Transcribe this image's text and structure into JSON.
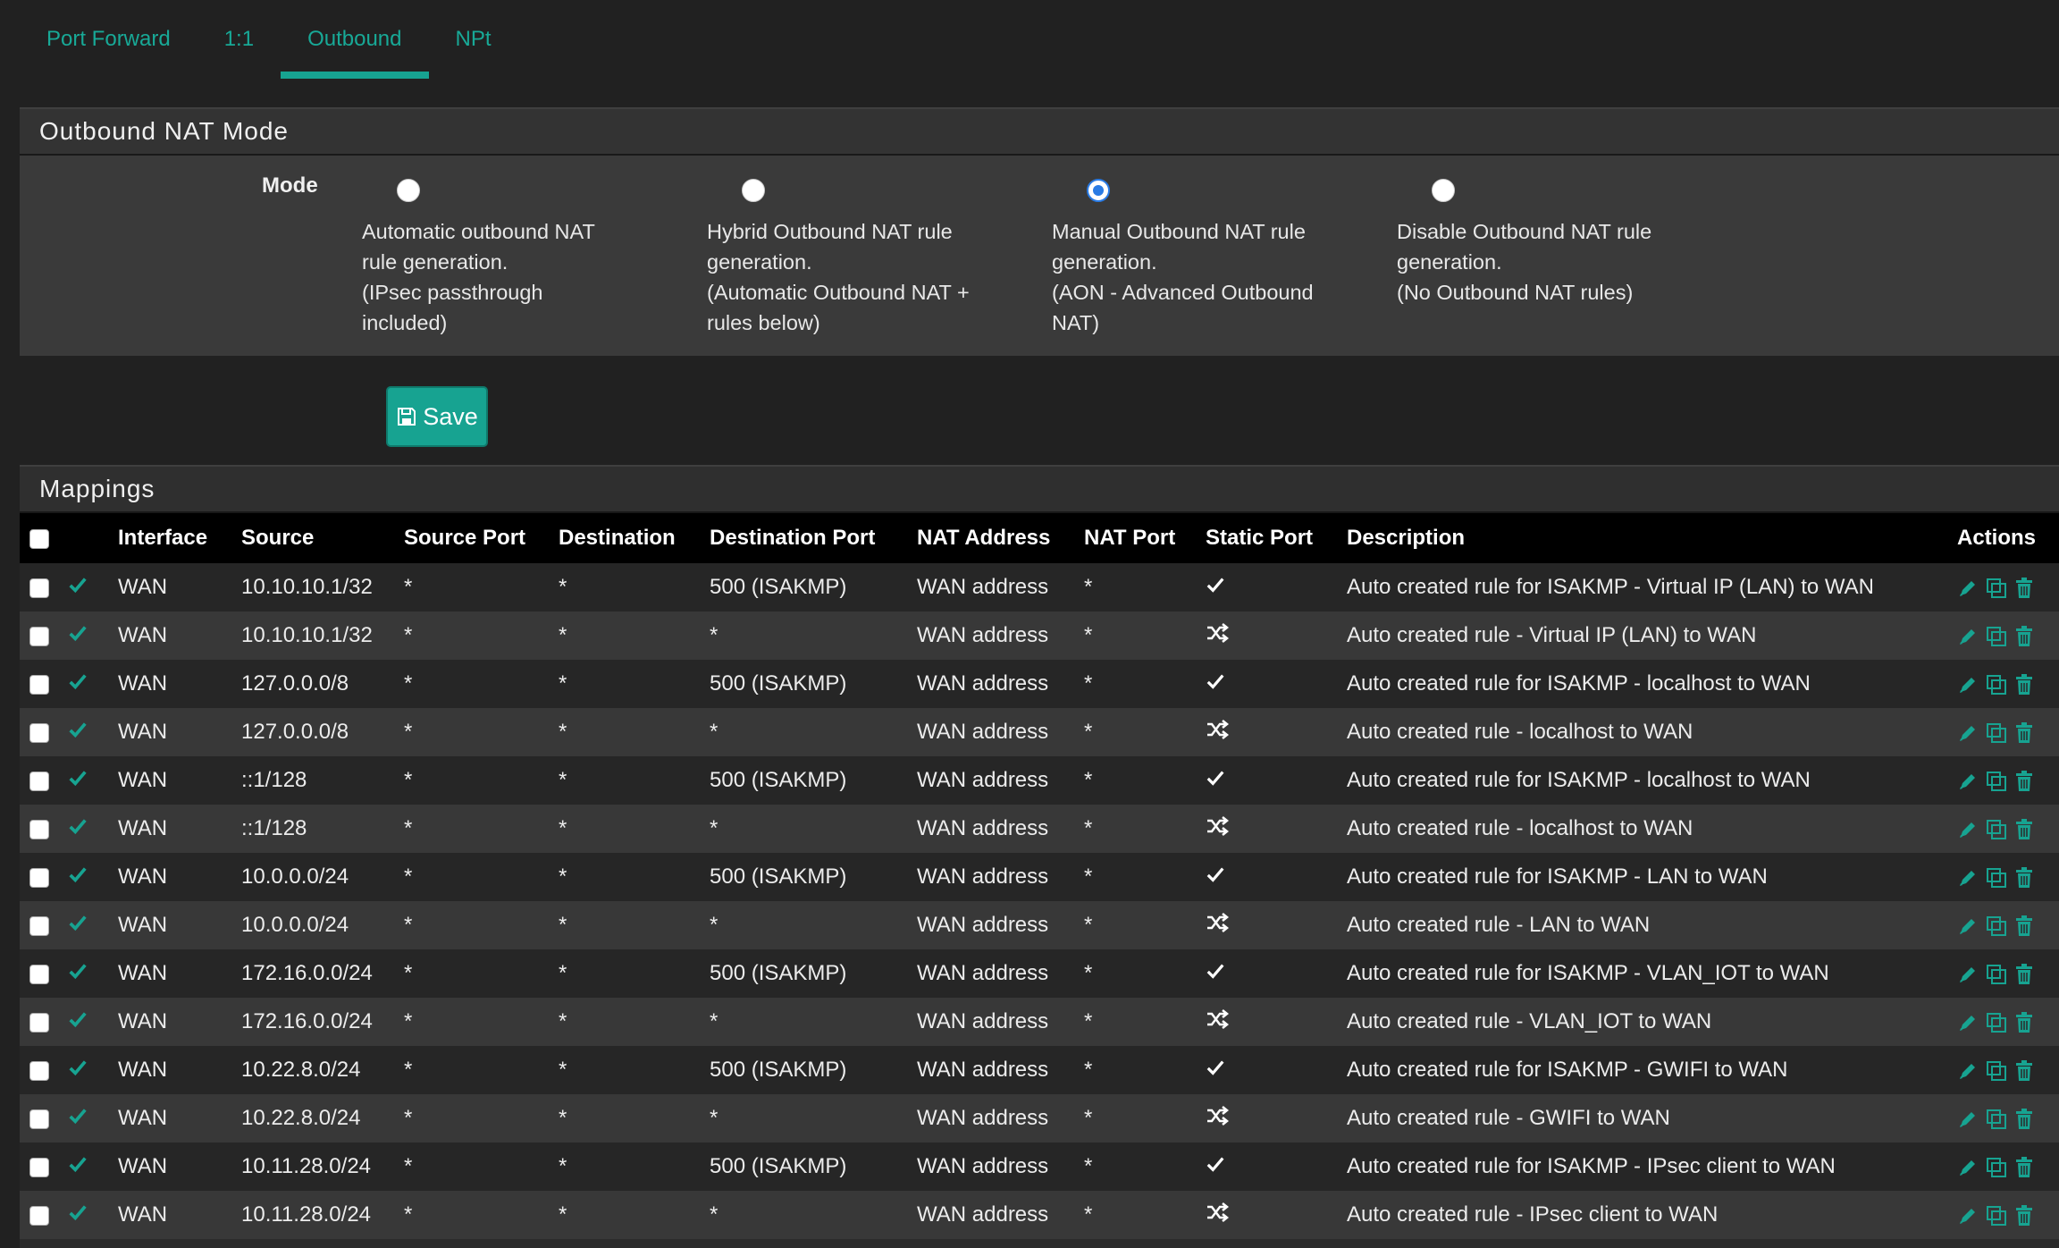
{
  "tabs": [
    "Port Forward",
    "1:1",
    "Outbound",
    "NPt"
  ],
  "active_tab": "Outbound",
  "mode_panel": {
    "title": "Outbound NAT Mode",
    "label": "Mode",
    "options": [
      {
        "text": "Automatic outbound NAT\nrule generation.\n(IPsec passthrough\nincluded)",
        "checked": false
      },
      {
        "text": "Hybrid Outbound NAT rule\ngeneration.\n(Automatic Outbound NAT +\nrules below)",
        "checked": false
      },
      {
        "text": "Manual Outbound NAT rule\ngeneration.\n(AON - Advanced Outbound\nNAT)",
        "checked": true
      },
      {
        "text": "Disable Outbound NAT rule\ngeneration.\n(No Outbound NAT rules)",
        "checked": false
      }
    ]
  },
  "save_label": "Save",
  "mappings": {
    "title": "Mappings",
    "columns": [
      "Interface",
      "Source",
      "Source Port",
      "Destination",
      "Destination Port",
      "NAT Address",
      "NAT Port",
      "Static Port",
      "Description",
      "Actions"
    ],
    "rows": [
      {
        "interface": "WAN",
        "source": "10.10.10.1/32",
        "source_port": "*",
        "destination": "*",
        "dest_port": "500 (ISAKMP)",
        "nat_address": "WAN address",
        "nat_port": "*",
        "static": "check",
        "description": "Auto created rule for ISAKMP - Virtual IP (LAN) to WAN"
      },
      {
        "interface": "WAN",
        "source": "10.10.10.1/32",
        "source_port": "*",
        "destination": "*",
        "dest_port": "*",
        "nat_address": "WAN address",
        "nat_port": "*",
        "static": "random",
        "description": "Auto created rule - Virtual IP (LAN) to WAN"
      },
      {
        "interface": "WAN",
        "source": "127.0.0.0/8",
        "source_port": "*",
        "destination": "*",
        "dest_port": "500 (ISAKMP)",
        "nat_address": "WAN address",
        "nat_port": "*",
        "static": "check",
        "description": "Auto created rule for ISAKMP - localhost to WAN"
      },
      {
        "interface": "WAN",
        "source": "127.0.0.0/8",
        "source_port": "*",
        "destination": "*",
        "dest_port": "*",
        "nat_address": "WAN address",
        "nat_port": "*",
        "static": "random",
        "description": "Auto created rule - localhost to WAN"
      },
      {
        "interface": "WAN",
        "source": "::1/128",
        "source_port": "*",
        "destination": "*",
        "dest_port": "500 (ISAKMP)",
        "nat_address": "WAN address",
        "nat_port": "*",
        "static": "check",
        "description": "Auto created rule for ISAKMP - localhost to WAN"
      },
      {
        "interface": "WAN",
        "source": "::1/128",
        "source_port": "*",
        "destination": "*",
        "dest_port": "*",
        "nat_address": "WAN address",
        "nat_port": "*",
        "static": "random",
        "description": "Auto created rule - localhost to WAN"
      },
      {
        "interface": "WAN",
        "source": "10.0.0.0/24",
        "source_port": "*",
        "destination": "*",
        "dest_port": "500 (ISAKMP)",
        "nat_address": "WAN address",
        "nat_port": "*",
        "static": "check",
        "description": "Auto created rule for ISAKMP - LAN to WAN"
      },
      {
        "interface": "WAN",
        "source": "10.0.0.0/24",
        "source_port": "*",
        "destination": "*",
        "dest_port": "*",
        "nat_address": "WAN address",
        "nat_port": "*",
        "static": "random",
        "description": "Auto created rule - LAN to WAN"
      },
      {
        "interface": "WAN",
        "source": "172.16.0.0/24",
        "source_port": "*",
        "destination": "*",
        "dest_port": "500 (ISAKMP)",
        "nat_address": "WAN address",
        "nat_port": "*",
        "static": "check",
        "description": "Auto created rule for ISAKMP - VLAN_IOT to WAN"
      },
      {
        "interface": "WAN",
        "source": "172.16.0.0/24",
        "source_port": "*",
        "destination": "*",
        "dest_port": "*",
        "nat_address": "WAN address",
        "nat_port": "*",
        "static": "random",
        "description": "Auto created rule - VLAN_IOT to WAN"
      },
      {
        "interface": "WAN",
        "source": "10.22.8.0/24",
        "source_port": "*",
        "destination": "*",
        "dest_port": "500 (ISAKMP)",
        "nat_address": "WAN address",
        "nat_port": "*",
        "static": "check",
        "description": "Auto created rule for ISAKMP - GWIFI to WAN"
      },
      {
        "interface": "WAN",
        "source": "10.22.8.0/24",
        "source_port": "*",
        "destination": "*",
        "dest_port": "*",
        "nat_address": "WAN address",
        "nat_port": "*",
        "static": "random",
        "description": "Auto created rule - GWIFI to WAN"
      },
      {
        "interface": "WAN",
        "source": "10.11.28.0/24",
        "source_port": "*",
        "destination": "*",
        "dest_port": "500 (ISAKMP)",
        "nat_address": "WAN address",
        "nat_port": "*",
        "static": "check",
        "description": "Auto created rule for ISAKMP - IPsec client to WAN"
      },
      {
        "interface": "WAN",
        "source": "10.11.28.0/24",
        "source_port": "*",
        "destination": "*",
        "dest_port": "*",
        "nat_address": "WAN address",
        "nat_port": "*",
        "static": "random",
        "description": "Auto created rule - IPsec client to WAN"
      }
    ]
  },
  "colors": {
    "accent": "#17a391",
    "radio_checked": "#2a7be4"
  }
}
